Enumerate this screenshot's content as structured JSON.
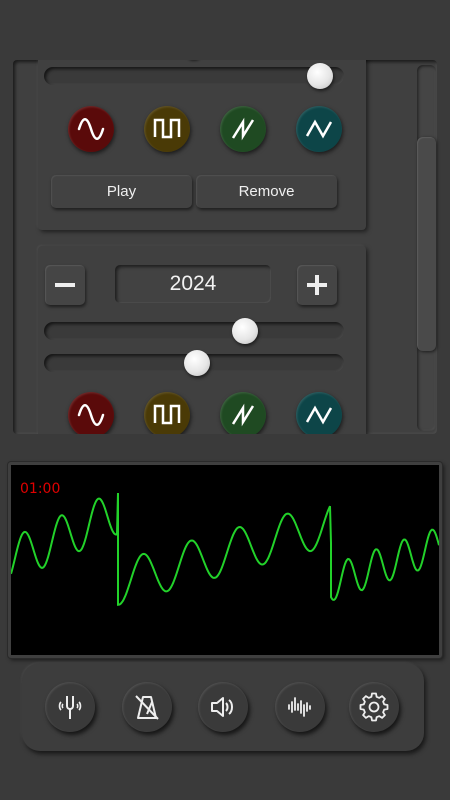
{
  "generator_card_1": {
    "slider_value": 0.92,
    "waveforms": [
      {
        "icon": "sine-wave-icon",
        "color": "#5a0a0a"
      },
      {
        "icon": "square-wave-icon",
        "color": "#4a3a06"
      },
      {
        "icon": "sawtooth-wave-icon",
        "color": "#1f4a22"
      },
      {
        "icon": "triangle-wave-icon",
        "color": "#0d4548"
      }
    ],
    "play_label": "Play",
    "remove_label": "Remove"
  },
  "generator_card_2": {
    "year_value": "2024",
    "slider1_value": 0.67,
    "slider2_value": 0.51,
    "waveforms": [
      {
        "icon": "sine-wave-icon",
        "color": "#5a0a0a"
      },
      {
        "icon": "square-wave-icon",
        "color": "#4a3a06"
      },
      {
        "icon": "sawtooth-wave-icon",
        "color": "#1f4a22"
      },
      {
        "icon": "triangle-wave-icon",
        "color": "#0d4548"
      }
    ]
  },
  "oscilloscope": {
    "time": "01:00",
    "trace_color": "#22d22a",
    "time_color": "#e00000"
  },
  "bottom_nav": [
    {
      "icon": "tuning-fork-icon"
    },
    {
      "icon": "metronome-muted-icon"
    },
    {
      "icon": "speaker-icon"
    },
    {
      "icon": "sound-wave-icon"
    },
    {
      "icon": "settings-gear-icon"
    }
  ]
}
